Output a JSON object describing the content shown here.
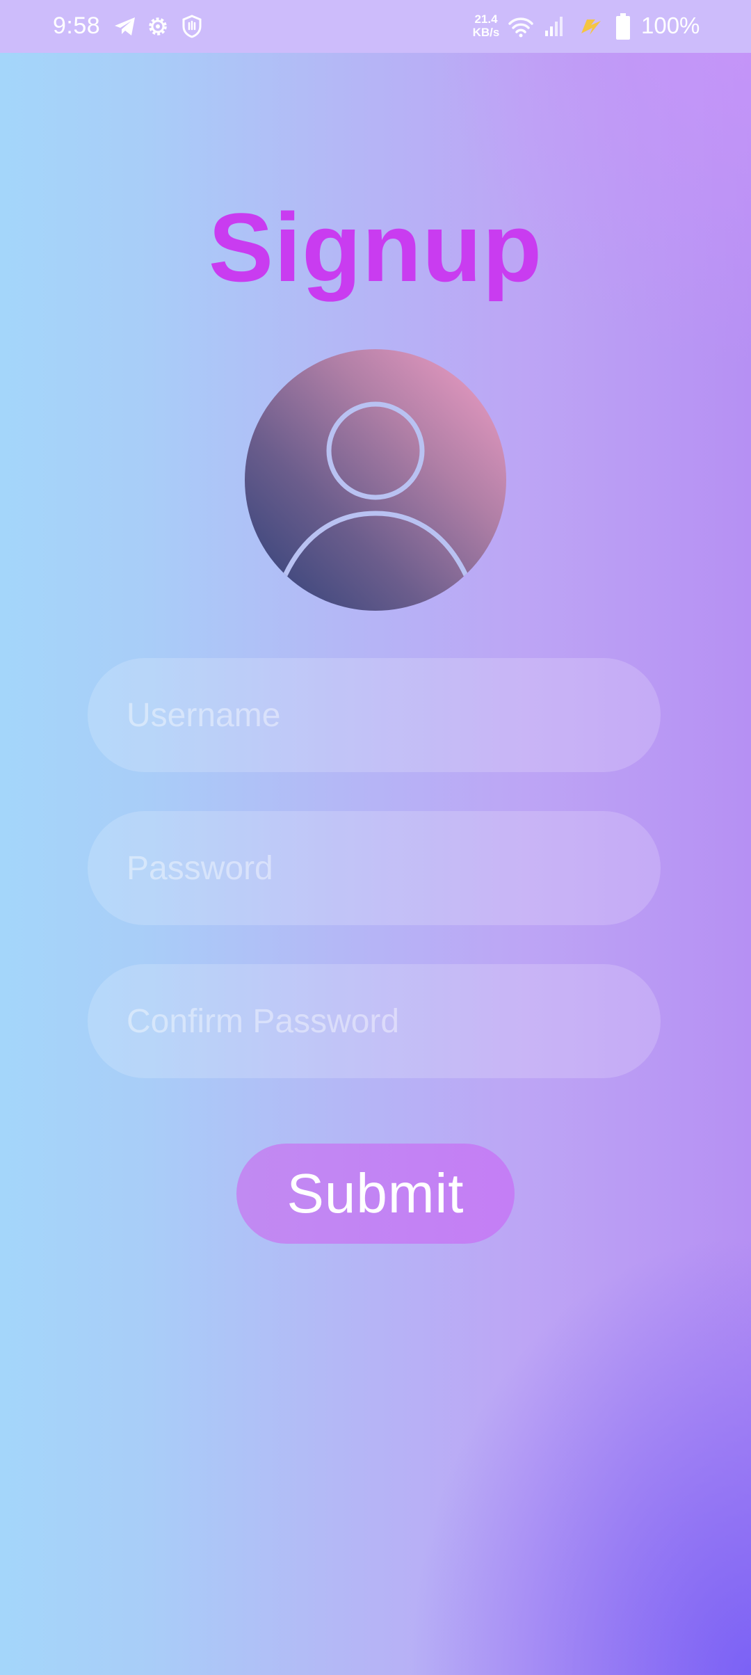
{
  "status_bar": {
    "time": "9:58",
    "net_speed_value": "21.4",
    "net_speed_unit": "KB/s",
    "battery_percent": "100%",
    "icons": [
      "telegram-icon",
      "settings-gear-icon",
      "hand-shield-icon",
      "wifi-icon",
      "signal-icon",
      "charging-bolt-icon",
      "battery-icon"
    ]
  },
  "signup": {
    "title": "Signup",
    "avatar_icon": "user-profile-icon",
    "fields": {
      "username_placeholder": "Username",
      "password_placeholder": "Password",
      "confirm_password_placeholder": "Confirm Password"
    },
    "submit_label": "Submit"
  },
  "colors": {
    "title": "#c93cf0",
    "status_bar_bg": "#cdbcfb",
    "submit_bg": "#c47ef5",
    "avatar_outline": "#b9c2f2"
  }
}
